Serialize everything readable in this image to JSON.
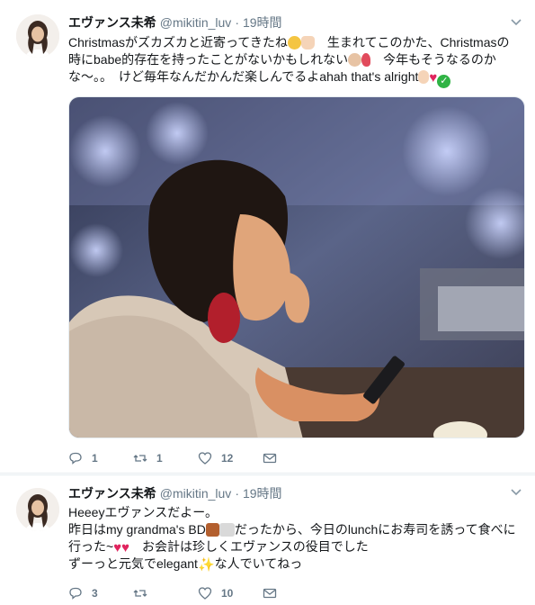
{
  "colors": {
    "link": "#1da1f2",
    "muted": "#657786",
    "heart": "#e0245e",
    "check": "#2fb344",
    "divider": "#e6ecf0"
  },
  "tweets": [
    {
      "name": "エヴァンス未希",
      "handle": "@mikitin_luv",
      "separator": "·",
      "time": "19時間",
      "lines": [
        {
          "a": "Christmasがズカズカと近寄ってきたね",
          "b": "　生まれてこのかた、Christmasの"
        },
        {
          "a": "時にbabe的存在を持ったことがないかもしれない",
          "b": "　今年もそうなるのか"
        },
        {
          "a": "な〜。。　けど毎年なんだかんだ楽しんでるよahah that's alright",
          "b": ""
        }
      ],
      "icons": [
        "pensive-face-icon",
        "raised-hand-icon",
        "girl-facepalm-icon",
        "rose-icon",
        "ok-hand-icon",
        "red-heart-icon",
        "check-mark-icon"
      ],
      "media": {
        "description_icon": "photo-icon"
      },
      "actions": {
        "reply": "1",
        "retweet": "1",
        "like": "12"
      }
    },
    {
      "name": "エヴァンス未希",
      "handle": "@mikitin_luv",
      "separator": "·",
      "time": "19時間",
      "lines": [
        {
          "a": "Heeeyエヴァンスだよー。"
        },
        {
          "a": "昨日はmy grandma's BD",
          "b": "だったから、今日のlunchにお寿司を誘って食べに"
        },
        {
          "a": "行った~",
          "b": "　お会計は珍しくエヴァンスの役目でした"
        },
        {
          "a": "ずーっと元気でelegant",
          "b": "な人でいてねっ"
        }
      ],
      "icons": [
        "birthday-cake-icon",
        "clinking-glasses-icon",
        "red-heart-icon",
        "sparkles-icon"
      ],
      "actions": {
        "reply": "3",
        "retweet": "",
        "like": "10"
      }
    }
  ]
}
